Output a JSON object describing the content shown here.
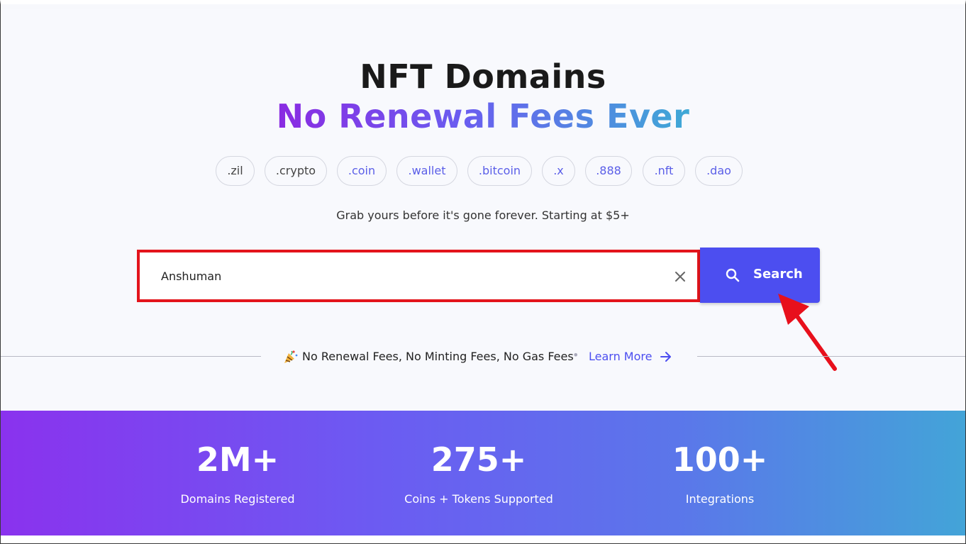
{
  "hero": {
    "title": "NFT Domains",
    "subtitle": "No Renewal Fees Ever",
    "tagline": "Grab yours before it's gone forever. Starting at $5+"
  },
  "tlds": [
    ".zil",
    ".crypto",
    ".coin",
    ".wallet",
    ".bitcoin",
    ".x",
    ".888",
    ".nft",
    ".dao"
  ],
  "search": {
    "value": "Anshuman",
    "button_label": "Search"
  },
  "promo": {
    "text": "No Renewal Fees, No Minting Fees, No Gas Fees",
    "separator": "•",
    "link_label": "Learn More"
  },
  "stats": [
    {
      "value": "2M+",
      "label": "Domains Registered"
    },
    {
      "value": "275+",
      "label": "Coins + Tokens Supported"
    },
    {
      "value": "100+",
      "label": "Integrations"
    }
  ],
  "colors": {
    "accent": "#4c4ef0",
    "highlight_border": "#e3141c",
    "annotation_arrow": "#e8101c",
    "tld_dark": "#444444",
    "tld_accent": "#5a5ee8"
  }
}
